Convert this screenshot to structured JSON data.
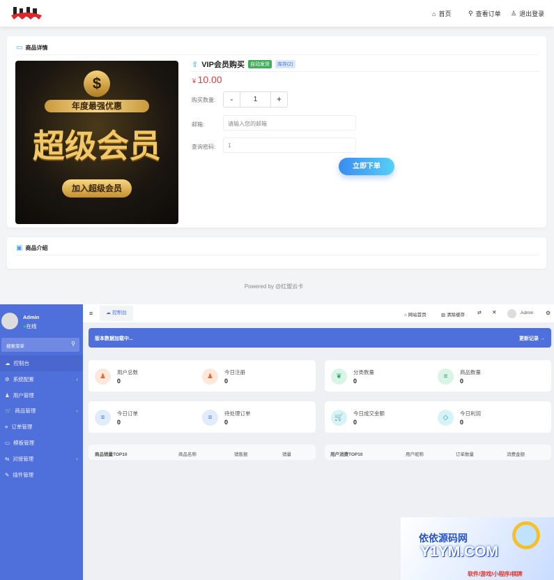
{
  "header": {
    "logo_text": "UM",
    "nav": [
      {
        "icon": "home-icon",
        "label": "首页"
      },
      {
        "icon": "search-icon",
        "label": "查看订单"
      },
      {
        "icon": "user-icon",
        "label": "退出登录"
      }
    ]
  },
  "product_card": {
    "title": "商品详情",
    "name": "VIP会员购买",
    "badge_auto": "自动发货",
    "badge_stock": "库存(2)",
    "price_symbol": "¥",
    "price": "10.00",
    "image": {
      "line1": "年度最强优惠",
      "line2": "超级会员",
      "button": "加入超级会员"
    },
    "qty_label": "购买数量:",
    "qty_minus": "-",
    "qty_value": "1",
    "qty_plus": "+",
    "email_label": "邮箱:",
    "email_placeholder": "请输入您的邮箱",
    "pwd_label": "查询密码:",
    "pwd_value": "1",
    "submit": "立即下单"
  },
  "intro_card": {
    "title": "商品介绍"
  },
  "footer": "Powered by @红盟云卡",
  "colors": {
    "accent": "#4f6fdb",
    "price": "#e03b3b",
    "button": "#3aa0f5"
  },
  "admin": {
    "user": "Admin",
    "status": "在线",
    "search_placeholder": "搜索菜单",
    "menu": [
      {
        "label": "控制台",
        "icon": "dashboard-icon",
        "active": true
      },
      {
        "label": "系统配置",
        "icon": "gear-icon",
        "arrow": true
      },
      {
        "label": "用户管理",
        "icon": "user-icon"
      },
      {
        "label": "商品管理",
        "icon": "cart-icon",
        "arrow": true
      },
      {
        "label": "订单管理",
        "icon": "list-icon"
      },
      {
        "label": "模板管理",
        "icon": "template-icon"
      },
      {
        "label": "对接管理",
        "icon": "connect-icon",
        "arrow": true
      },
      {
        "label": "插件管理",
        "icon": "plugin-icon"
      }
    ],
    "tab": "控制台",
    "topbar": {
      "home": "网站首页",
      "clear": "清除缓存",
      "user": "Admin"
    },
    "banner": {
      "text": "版本数据加载中...",
      "link": "更新记录 →"
    },
    "stats": [
      {
        "label": "用户总数",
        "value": "0",
        "icon": "users-icon"
      },
      {
        "label": "今日注册",
        "value": "0",
        "icon": "user-icon"
      },
      {
        "label": "分类数量",
        "value": "0",
        "icon": "leaf-icon"
      },
      {
        "label": "商品数量",
        "value": "0",
        "icon": "list-icon"
      },
      {
        "label": "今日订单",
        "value": "0",
        "icon": "list-icon"
      },
      {
        "label": "待处理订单",
        "value": "0",
        "icon": "list-icon"
      },
      {
        "label": "今日成交金额",
        "value": "0",
        "icon": "cart-icon"
      },
      {
        "label": "今日利润",
        "value": "0",
        "icon": "diamond-icon"
      }
    ],
    "table1": [
      "商品销量TOP10",
      "商品名称",
      "销售额",
      "销量"
    ],
    "table2": [
      "用户消费TOP10",
      "用户昵称",
      "订单数量",
      "消费金额"
    ]
  },
  "watermark": {
    "line1": "依依源码网",
    "line2": "Y1YM.COM",
    "line3": "软件/游戏/小程序/棋牌"
  }
}
